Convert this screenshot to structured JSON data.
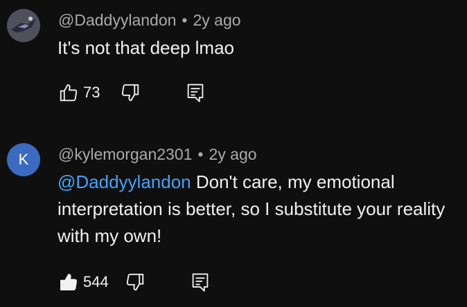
{
  "comments": [
    {
      "author": "@Daddyylandon",
      "separator": "•",
      "time": "2y ago",
      "text": "It's not that deep lmao",
      "likes": "73",
      "liked": false
    },
    {
      "avatar_letter": "K",
      "avatar_color": "#3a6bc0",
      "author": "@kylemorgan2301",
      "separator": "•",
      "time": "2y ago",
      "mention": "@Daddyylandon",
      "text": " Don't care, my emotional interpretation is better, so I substitute your reality with my own!",
      "likes": "544",
      "liked": true
    }
  ],
  "icons": {
    "like": "thumbs-up-icon",
    "dislike": "thumbs-down-icon",
    "reply": "reply-comment-icon"
  }
}
